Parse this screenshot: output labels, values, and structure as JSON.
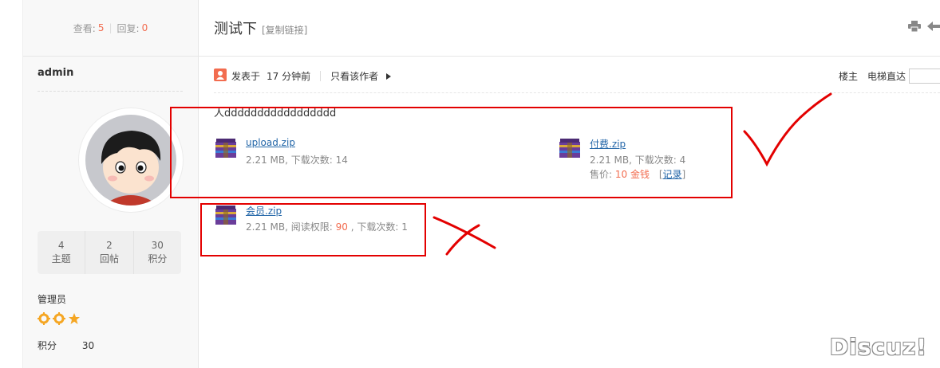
{
  "sidebar": {
    "views_label": "查看:",
    "views_value": "5",
    "replies_label": "回复:",
    "replies_value": "0",
    "separator": "|",
    "username": "admin",
    "counts": [
      {
        "value": "4",
        "label": "主题"
      },
      {
        "value": "2",
        "label": "回帖"
      },
      {
        "value": "30",
        "label": "积分"
      }
    ],
    "role": "管理员",
    "points_label": "积分",
    "points_value": "30"
  },
  "thread": {
    "title": "测试下",
    "copy_link": "[复制链接]",
    "posted_prefix": "发表于",
    "posted_time": "17 分钟前",
    "only_author": "只看该作者",
    "floor_label": "楼主",
    "jump_label": "电梯直达",
    "content": "人ddddddddddddddddd"
  },
  "attachments": [
    {
      "name": "upload.zip",
      "info": "2.21 MB, 下载次数: 14"
    },
    {
      "name": "付费.zip",
      "info": "2.21 MB, 下载次数: 4",
      "price_label": "售价:",
      "price_value": "10",
      "price_unit": "金钱",
      "record": "记录"
    },
    {
      "name": "会员.zip",
      "info_prefix": "2.21 MB, 阅读权限:",
      "permission": "90",
      "info_suffix": ", 下载次数: 1"
    }
  ],
  "icons": [
    "print-icon",
    "back-arrow-icon",
    "user-icon",
    "play-triangle-icon",
    "archive-icon",
    "star-icon",
    "sun-icon"
  ],
  "colors": {
    "accent_orange": "#f26c4f",
    "link_blue": "#2366a8",
    "annotation_red": "#e30000"
  },
  "watermark": "Discuz!"
}
